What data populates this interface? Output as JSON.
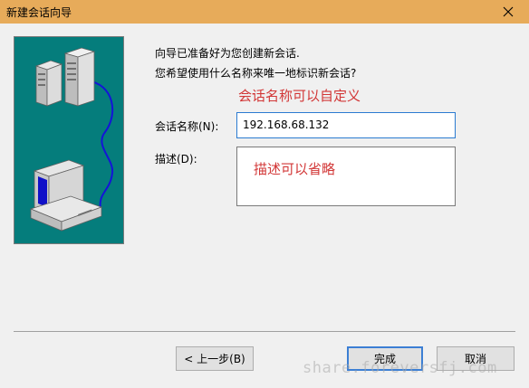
{
  "window": {
    "title": "新建会话向导",
    "accent_color": "#e7ab5a"
  },
  "illustration": {
    "description_icons": [
      "server-icon",
      "computer-icon"
    ],
    "background_color": "#057d7c"
  },
  "wizard": {
    "line1": "向导已准备好为您创建新会话.",
    "line2": "您希望使用什么名称来唯一地标识新会话?",
    "annotation_name": "会话名称可以自定义",
    "name_label": "会话名称(N):",
    "name_value": "192.168.68.132",
    "desc_label": "描述(D):",
    "desc_value": "",
    "annotation_desc": "描述可以省略"
  },
  "buttons": {
    "back": "< 上一步(B)",
    "finish": "完成",
    "cancel": "取消"
  },
  "watermark": "share.foreversfj.com"
}
